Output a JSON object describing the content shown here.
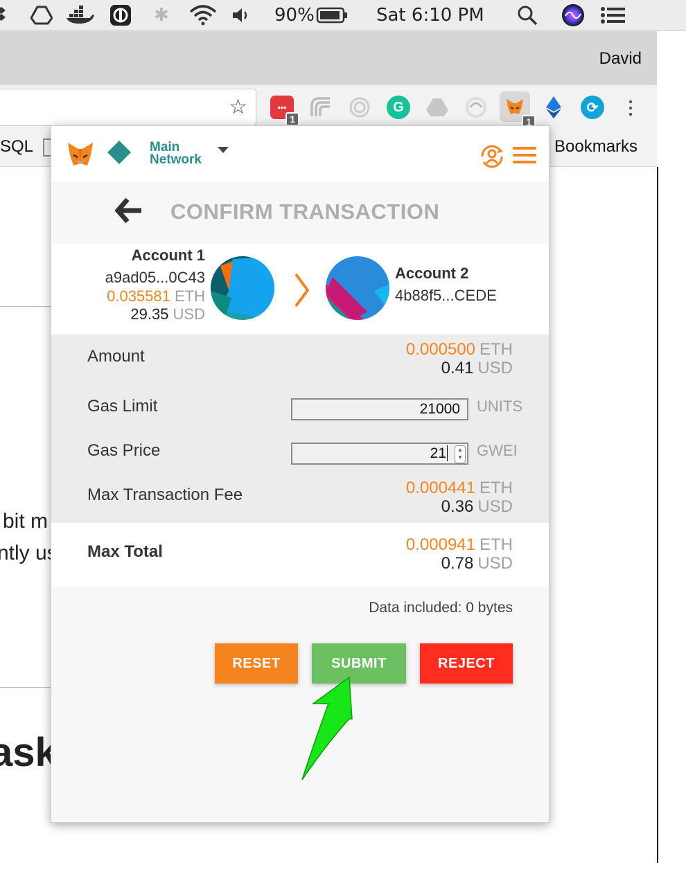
{
  "menubar": {
    "battery": "90%",
    "clock": "Sat 6:10 PM"
  },
  "browser": {
    "profile_name": "David",
    "bookmarks_left": "SQL",
    "bookmarks_right": "Bookmarks",
    "extension_badges": [
      "1",
      "1"
    ]
  },
  "page": {
    "text_line1": "bit m",
    "text_line2": "ntly us",
    "heading_fragment": "ask"
  },
  "metamask": {
    "network": {
      "line1": "Main",
      "line2": "Network"
    },
    "title": "CONFIRM TRANSACTION",
    "from": {
      "name": "Account 1",
      "address": "a9ad05...0C43",
      "eth_balance": "0.035581",
      "eth_unit": "ETH",
      "usd_balance": "29.35",
      "usd_unit": "USD"
    },
    "to": {
      "name": "Account 2",
      "address": "4b88f5...CEDE"
    },
    "amount": {
      "label": "Amount",
      "eth": "0.000500",
      "eth_unit": "ETH",
      "usd": "0.41",
      "usd_unit": "USD"
    },
    "gas_limit": {
      "label": "Gas Limit",
      "value": "21000",
      "unit": "UNITS"
    },
    "gas_price": {
      "label": "Gas Price",
      "value": "21",
      "unit": "GWEI"
    },
    "max_fee": {
      "label": "Max Transaction Fee",
      "eth": "0.000441",
      "eth_unit": "ETH",
      "usd": "0.36",
      "usd_unit": "USD"
    },
    "max_total": {
      "label": "Max Total",
      "eth": "0.000941",
      "eth_unit": "ETH",
      "usd": "0.78",
      "usd_unit": "USD"
    },
    "data_included": "Data included: 0 bytes",
    "buttons": {
      "reset": "RESET",
      "submit": "SUBMIT",
      "reject": "REJECT"
    },
    "colors": {
      "orange": "#f5841f",
      "green": "#6cc062",
      "red": "#ff2d1f",
      "teal": "#2a8f8c"
    }
  }
}
